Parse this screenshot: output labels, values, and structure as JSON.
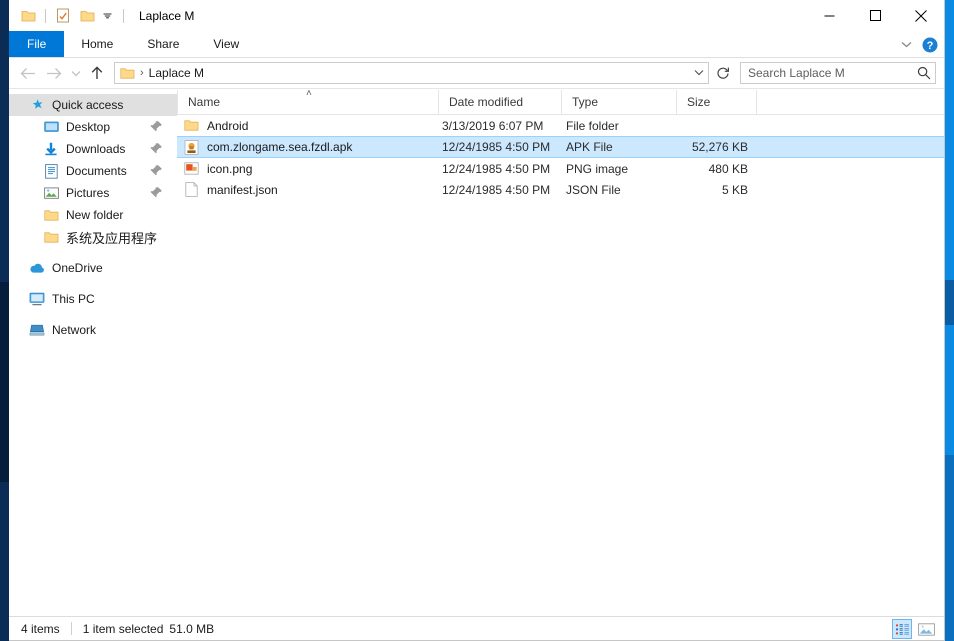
{
  "window": {
    "title": "Laplace M",
    "controls": {
      "minimize": "Minimize",
      "maximize": "Maximize",
      "close": "Close"
    }
  },
  "quick_access_toolbar": {
    "items": [
      {
        "name": "pin-to-quick-access",
        "icon": "folder-icon"
      },
      {
        "name": "properties",
        "icon": "properties-icon"
      },
      {
        "name": "new-folder",
        "icon": "new-folder-icon"
      },
      {
        "name": "customize",
        "icon": "chevron-down-icon"
      }
    ]
  },
  "ribbon": {
    "tabs": [
      {
        "label": "File",
        "active": true
      },
      {
        "label": "Home",
        "active": false
      },
      {
        "label": "Share",
        "active": false
      },
      {
        "label": "View",
        "active": false
      }
    ],
    "expand_icon": "chevron-down-icon",
    "help_icon": "help-icon"
  },
  "navigation": {
    "back": "Back",
    "forward": "Forward",
    "recent": "Recent locations",
    "up": "Up",
    "breadcrumb": {
      "folder_icon": "folder-icon",
      "separator": "›",
      "path": "Laplace M"
    },
    "dropdown_icon": "chevron-down-icon",
    "refresh_icon": "refresh-icon"
  },
  "search": {
    "placeholder": "Search Laplace M",
    "value": "",
    "icon": "search-icon"
  },
  "sidebar": {
    "items": [
      {
        "label": "Quick access",
        "icon": "star-icon",
        "selected": true,
        "sub": false,
        "pinned": false
      },
      {
        "label": "Desktop",
        "icon": "desktop-icon",
        "selected": false,
        "sub": true,
        "pinned": true
      },
      {
        "label": "Downloads",
        "icon": "downloads-icon",
        "selected": false,
        "sub": true,
        "pinned": true
      },
      {
        "label": "Documents",
        "icon": "documents-icon",
        "selected": false,
        "sub": true,
        "pinned": true
      },
      {
        "label": "Pictures",
        "icon": "pictures-icon",
        "selected": false,
        "sub": true,
        "pinned": true
      },
      {
        "label": "New folder",
        "icon": "folder-icon",
        "selected": false,
        "sub": true,
        "pinned": false
      },
      {
        "label": "系统及应用程序",
        "icon": "folder-icon",
        "selected": false,
        "sub": true,
        "pinned": false
      },
      {
        "label": "OneDrive",
        "icon": "onedrive-icon",
        "selected": false,
        "sub": false,
        "pinned": false,
        "gap_before": true
      },
      {
        "label": "This PC",
        "icon": "this-pc-icon",
        "selected": false,
        "sub": false,
        "pinned": false,
        "gap_before": true
      },
      {
        "label": "Network",
        "icon": "network-icon",
        "selected": false,
        "sub": false,
        "pinned": false,
        "gap_before": true
      }
    ]
  },
  "file_list": {
    "columns": [
      {
        "label": "Name",
        "sorted": "asc"
      },
      {
        "label": "Date modified",
        "sorted": null
      },
      {
        "label": "Type",
        "sorted": null
      },
      {
        "label": "Size",
        "sorted": null
      }
    ],
    "sort_caret": "˄",
    "rows": [
      {
        "name": "Android",
        "date": "3/13/2019 6:07 PM",
        "type": "File folder",
        "size": "",
        "icon": "folder-icon",
        "selected": false
      },
      {
        "name": "com.zlongame.sea.fzdl.apk",
        "date": "12/24/1985 4:50 PM",
        "type": "APK File",
        "size": "52,276 KB",
        "icon": "apk-file-icon",
        "selected": true
      },
      {
        "name": "icon.png",
        "date": "12/24/1985 4:50 PM",
        "type": "PNG image",
        "size": "480 KB",
        "icon": "png-image-icon",
        "selected": false
      },
      {
        "name": "manifest.json",
        "date": "12/24/1985 4:50 PM",
        "type": "JSON File",
        "size": "5 KB",
        "icon": "json-file-icon",
        "selected": false
      }
    ]
  },
  "status_bar": {
    "item_count": "4 items",
    "selection": "1 item selected",
    "selection_size": "51.0 MB",
    "view_details": "Details view",
    "view_large_icons": "Large icons view"
  },
  "colors": {
    "accent": "#0078d7",
    "selection": "#cce8ff",
    "folder": "#ffd285",
    "desktop": "#0b86e0"
  }
}
